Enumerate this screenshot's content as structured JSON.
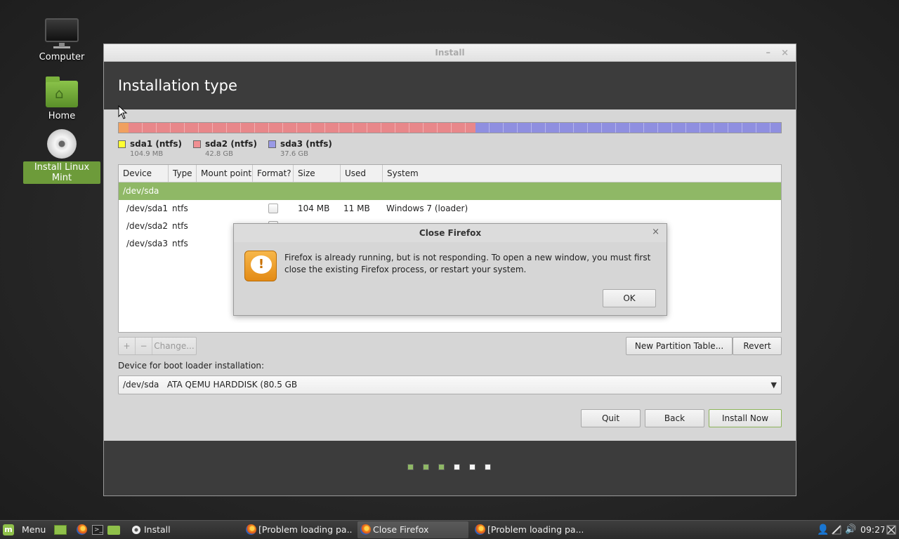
{
  "desktop": {
    "icons": [
      {
        "label": "Computer"
      },
      {
        "label": "Home"
      },
      {
        "label": "Install Linux Mint"
      }
    ]
  },
  "window": {
    "title": "Install",
    "minimize": "–",
    "close": "×",
    "header_title": "Installation type"
  },
  "partitions": {
    "bar_fractions": [
      0.0013,
      0.531,
      0.467
    ],
    "colors": {
      "sda1": "#ffff33",
      "sda2": "#e8878a",
      "sda3": "#8f8fe0"
    },
    "legend": [
      {
        "name": "sda1 (ntfs)",
        "size": "104.9 MB",
        "color": "#ffff33"
      },
      {
        "name": "sda2 (ntfs)",
        "size": "42.8 GB",
        "color": "#f08f92"
      },
      {
        "name": "sda3 (ntfs)",
        "size": "37.6 GB",
        "color": "#9a9ae6"
      }
    ]
  },
  "table": {
    "columns": [
      "Device",
      "Type",
      "Mount point",
      "Format?",
      "Size",
      "Used",
      "System"
    ],
    "group": "/dev/sda",
    "rows": [
      {
        "device": "/dev/sda1",
        "type": "ntfs",
        "mount": "",
        "size": "104 MB",
        "used": "11 MB",
        "system": "Windows 7 (loader)"
      },
      {
        "device": "/dev/sda2",
        "type": "ntfs",
        "mount": "",
        "size": "",
        "used": "",
        "system": ""
      },
      {
        "device": "/dev/sda3",
        "type": "ntfs",
        "mount": "",
        "size": "",
        "used": "",
        "system": ""
      }
    ]
  },
  "buttons": {
    "add": "+",
    "remove": "−",
    "change": "Change...",
    "new_partition_table": "New Partition Table...",
    "revert": "Revert",
    "quit": "Quit",
    "back": "Back",
    "install_now": "Install Now"
  },
  "bootloader": {
    "label": "Device for boot loader installation:",
    "selected": "/dev/sda   ATA QEMU HARDDISK (80.5 GB",
    "arrow": "▼"
  },
  "progress": {
    "total_steps": 6,
    "completed_steps": 3,
    "done_color": "#8fb866",
    "todo_color": "#f5f5f5"
  },
  "dialog": {
    "title": "Close Firefox",
    "close": "×",
    "message": "Firefox is already running, but is not responding. To open a new window, you must first close the existing Firefox process, or restart your system.",
    "ok": "OK",
    "icon_glyph": "!"
  },
  "taskbar": {
    "menu_label": "Menu",
    "tasks": [
      {
        "label": "Install"
      },
      {
        "label": "[Problem loading pa..."
      },
      {
        "label": "Close Firefox"
      },
      {
        "label": "[Problem loading pa..."
      }
    ],
    "clock": "09:27"
  }
}
